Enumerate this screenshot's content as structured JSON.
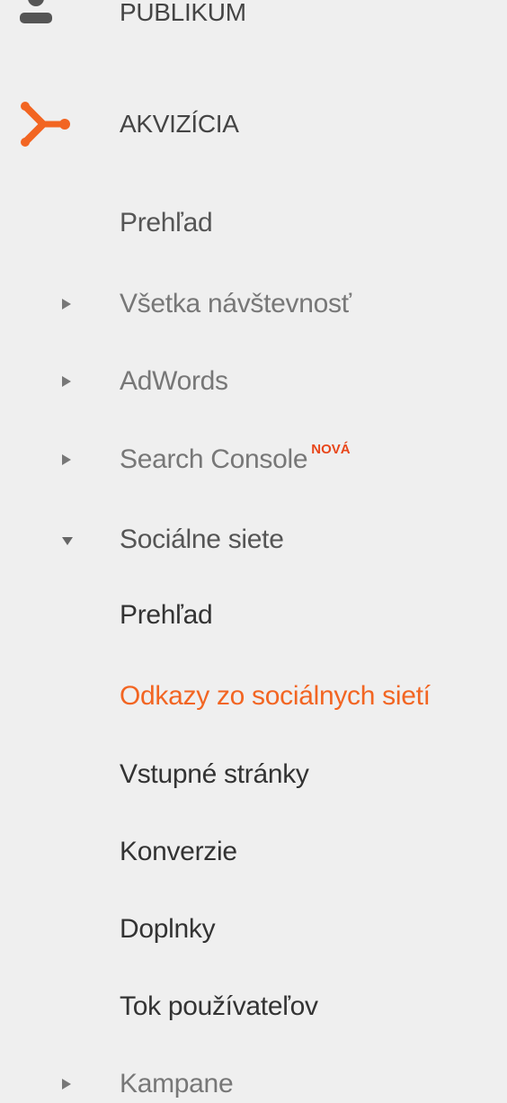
{
  "sections": {
    "audience": {
      "label": "PUBLIKUM",
      "icon": "person-icon"
    },
    "acquisition": {
      "label": "AKVIZÍCIA",
      "icon": "acquisition-icon",
      "color": "#f26522"
    }
  },
  "nav": {
    "overview": "Prehľad",
    "all_traffic": "Všetka návštevnosť",
    "adwords": "AdWords",
    "search_console": "Search Console",
    "search_console_badge": "NOVÁ",
    "social": "Sociálne siete",
    "social_items": [
      "Prehľad",
      "Odkazy zo sociálnych sietí",
      "Vstupné stránky",
      "Konverzie",
      "Doplnky",
      "Tok používateľov"
    ],
    "campaigns": "Kampane"
  },
  "colors": {
    "accent": "#f26522",
    "badge": "#e8461a",
    "background": "#efefef"
  }
}
